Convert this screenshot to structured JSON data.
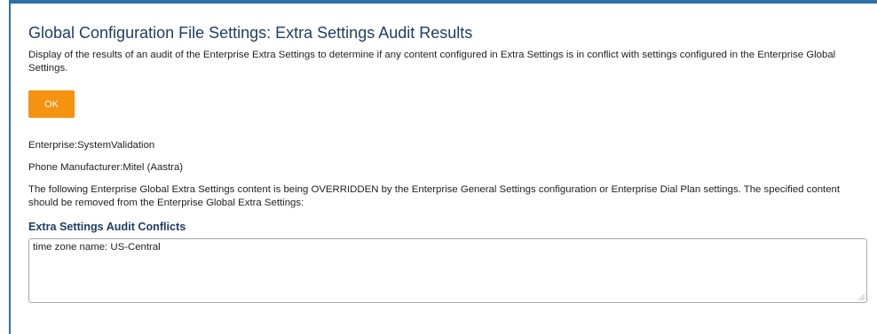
{
  "title": "Global Configuration File Settings: Extra Settings Audit Results",
  "description": "Display of the results of an audit of the Enterprise Extra Settings to determine if any content configured in Extra Settings is in conflict with settings configured in the Enterprise Global Settings.",
  "ok_label": "OK",
  "enterprise_line": "Enterprise:SystemValidation",
  "manufacturer_line": "Phone Manufacturer:Mitel (Aastra)",
  "override_text": "The following Enterprise Global Extra Settings content is being OVERRIDDEN by the Enterprise General Settings configuration or Enterprise Dial Plan settings. The specified content should be removed from the Enterprise Global Extra Settings:",
  "conflicts": {
    "heading": "Extra Settings Audit Conflicts",
    "value": "time zone name: US-Central"
  },
  "colors": {
    "accent": "#f5920f",
    "heading": "#1d3f61",
    "frame": "#2e6fa8"
  }
}
